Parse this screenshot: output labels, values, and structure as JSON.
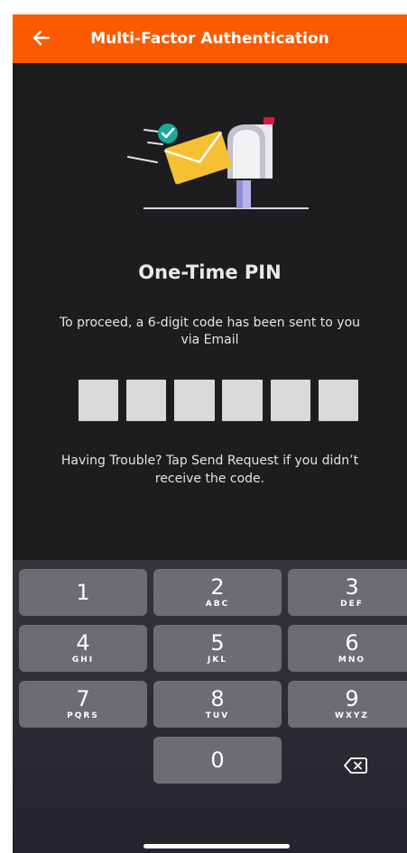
{
  "header": {
    "title": "Multi-Factor Authentication",
    "back_icon": "arrow-left-icon"
  },
  "illustration": {
    "name": "mailbox-envelope-illustration"
  },
  "main": {
    "heading": "One-Time PIN",
    "instruction": "To proceed, a 6-digit code has been sent to you via Email",
    "pin_length": 6,
    "help_text": "Having Trouble? Tap Send Request if you didn’t receive the code."
  },
  "keypad": {
    "keys": [
      {
        "num": "1",
        "letters": ""
      },
      {
        "num": "2",
        "letters": "ABC"
      },
      {
        "num": "3",
        "letters": "DEF"
      },
      {
        "num": "4",
        "letters": "GHI"
      },
      {
        "num": "5",
        "letters": "JKL"
      },
      {
        "num": "6",
        "letters": "MNO"
      },
      {
        "num": "7",
        "letters": "PQRS"
      },
      {
        "num": "8",
        "letters": "TUV"
      },
      {
        "num": "9",
        "letters": "WXYZ"
      },
      {
        "num": "0",
        "letters": ""
      }
    ],
    "delete_icon": "backspace-icon"
  },
  "colors": {
    "accent": "#fb5a00",
    "background": "#1d1d20",
    "key": "#6c6c72",
    "pin_box": "#d9d9d9"
  }
}
